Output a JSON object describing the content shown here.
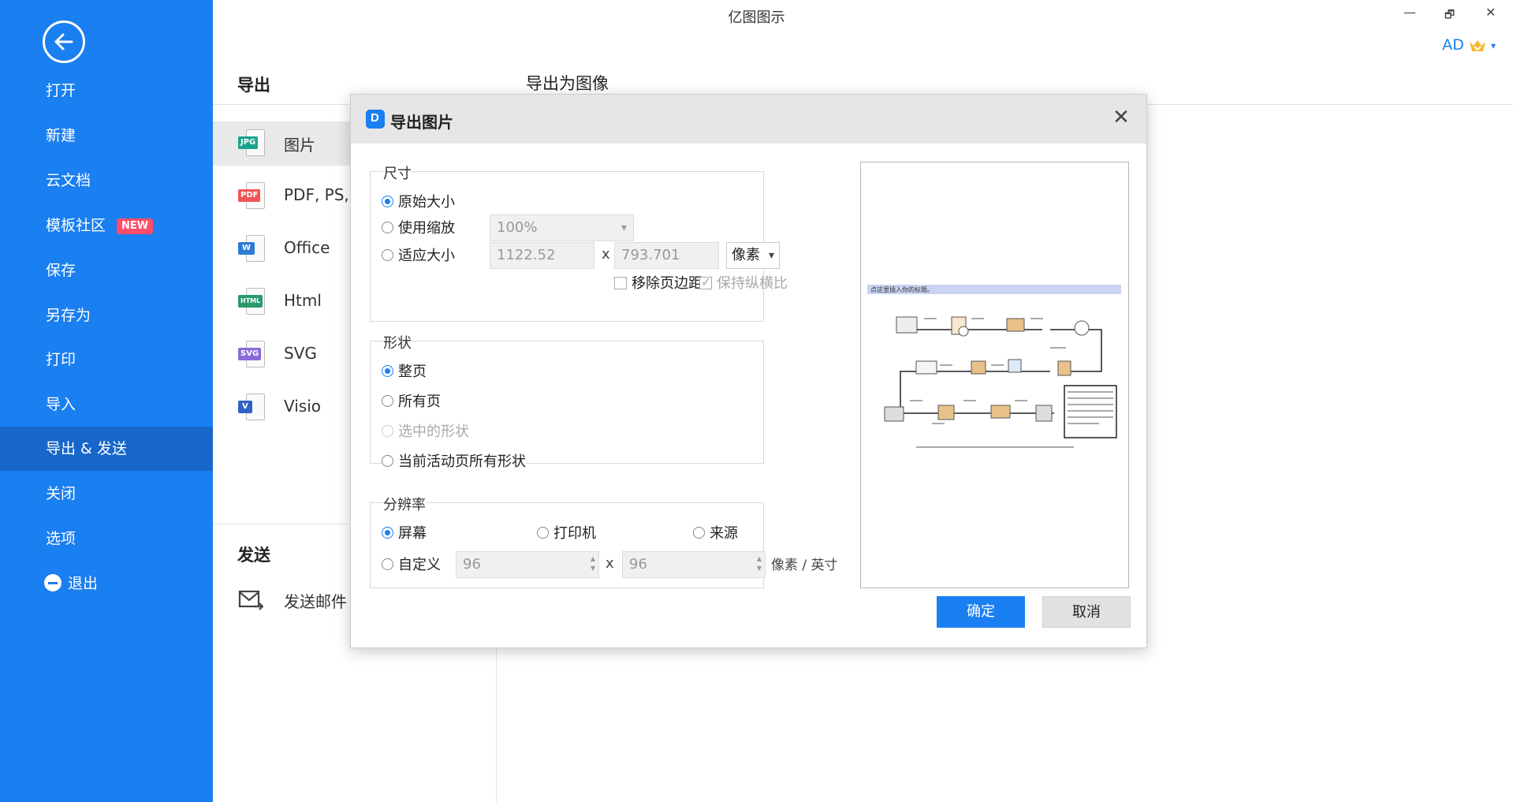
{
  "app": {
    "title": "亿图图示"
  },
  "window": {
    "minimize": "—",
    "restore": "🗗",
    "close": "✕"
  },
  "user": {
    "initials": "AD"
  },
  "sidebar": {
    "items": [
      {
        "label": "打开"
      },
      {
        "label": "新建"
      },
      {
        "label": "云文档"
      },
      {
        "label": "模板社区",
        "badge": "NEW"
      },
      {
        "label": "保存"
      },
      {
        "label": "另存为"
      },
      {
        "label": "打印"
      },
      {
        "label": "导入"
      },
      {
        "label": "导出 & 发送",
        "active": true
      },
      {
        "label": "关闭"
      },
      {
        "label": "选项"
      },
      {
        "label": "退出"
      }
    ]
  },
  "export": {
    "section_title": "导出",
    "heading": "导出为图像",
    "items": [
      {
        "label": "图片",
        "tag": "JPG",
        "color": "#1aa38a"
      },
      {
        "label": "PDF, PS,",
        "tag": "PDF",
        "color": "#f05454"
      },
      {
        "label": "Office",
        "tag": "W",
        "color": "#2b7cd3"
      },
      {
        "label": "Html",
        "tag": "HTML",
        "color": "#2a9a6e"
      },
      {
        "label": "SVG",
        "tag": "SVG",
        "color": "#8a6ad8"
      },
      {
        "label": "Visio",
        "tag": "V",
        "color": "#2f62c4"
      }
    ]
  },
  "send": {
    "section_title": "发送",
    "email_label": "发送邮件"
  },
  "dialog": {
    "title": "导出图片",
    "size": {
      "title": "尺寸",
      "original": "原始大小",
      "use_scale": "使用缩放",
      "scale_value": "100%",
      "fit_size": "适应大小",
      "width": "1122.52",
      "x": "x",
      "height": "793.701",
      "unit": "像素",
      "remove_margin": "移除页边距",
      "keep_ratio": "保持纵横比"
    },
    "shape": {
      "title": "形状",
      "whole_page": "整页",
      "all_pages": "所有页",
      "selected": "选中的形状",
      "active_page_all": "当前活动页所有形状"
    },
    "resolution": {
      "title": "分辨率",
      "screen": "屏幕",
      "printer": "打印机",
      "source": "来源",
      "custom": "自定义",
      "x_value": "96",
      "x": "x",
      "y_value": "96",
      "unit": "像素 / 英寸"
    },
    "preview": {
      "banner": "点这里插入你的标题。"
    },
    "ok": "确定",
    "cancel": "取消"
  }
}
